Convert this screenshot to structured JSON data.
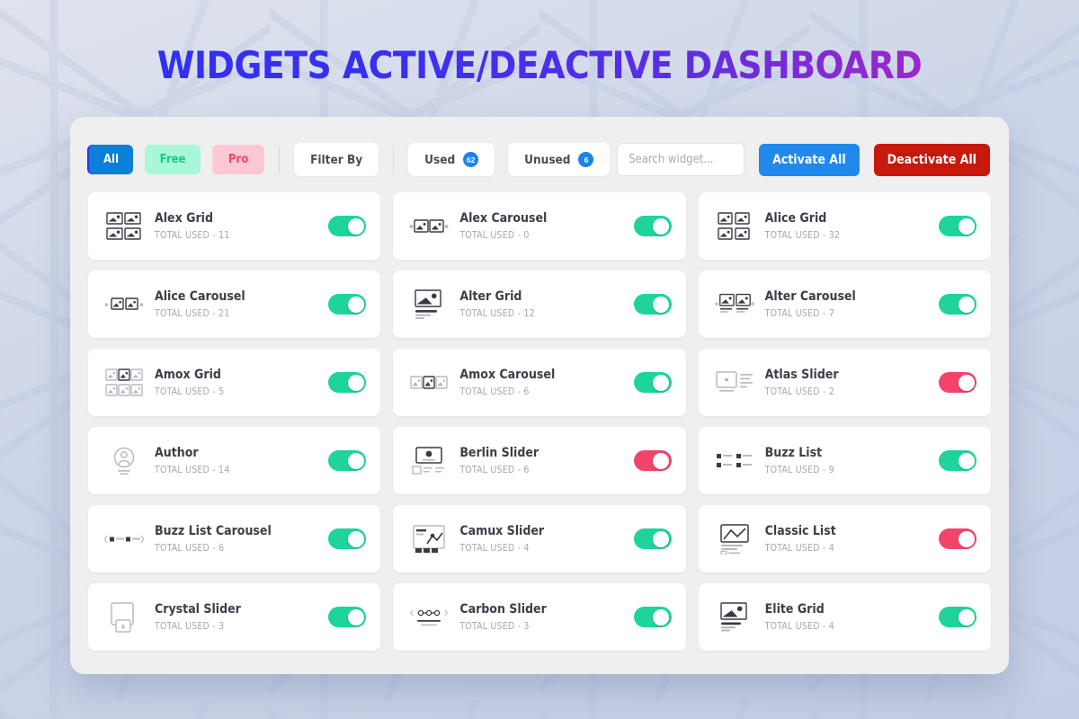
{
  "page": {
    "title": "Widgets Active/Deactive Dashboard",
    "title_gradient_from": "#2f2ff5",
    "title_gradient_to": "#c32bb0"
  },
  "toolbar": {
    "type_filters": [
      {
        "label": "All",
        "state": "active",
        "bg": "#0d7fd6",
        "fg": "#ffffff"
      },
      {
        "label": "Free",
        "state": "default",
        "bg": "#a7f7d8",
        "fg": "#16c98d"
      },
      {
        "label": "Pro",
        "state": "default",
        "bg": "#fcc8d3",
        "fg": "#f2446a"
      }
    ],
    "filter_by_label": "Filter By",
    "usage_chips": [
      {
        "label": "Used",
        "count": "62"
      },
      {
        "label": "Unused",
        "count": "6"
      }
    ],
    "search": {
      "placeholder": "Search widget...",
      "value": ""
    },
    "activate_all_label": "Activate All",
    "deactivate_all_label": "Deactivate All",
    "activate_color": "#2189ec",
    "deactivate_color": "#c7190b"
  },
  "legend": {
    "used_prefix": "TOTAL USED - ",
    "toggle_on_color": "#1ed49c",
    "toggle_off_color": "#f2446b"
  },
  "widgets": [
    {
      "name": "Alex Grid",
      "used": "TOTAL USED - 11",
      "state": "on",
      "icon": "image-grid-2x2-icon"
    },
    {
      "name": "Alex Carousel",
      "used": "TOTAL USED - 0",
      "state": "on",
      "icon": "image-carousel-icon"
    },
    {
      "name": "Alice Grid",
      "used": "TOTAL USED - 32",
      "state": "on",
      "icon": "portrait-grid-2x2-icon"
    },
    {
      "name": "Alice Carousel",
      "used": "TOTAL USED - 21",
      "state": "on",
      "icon": "portrait-carousel-icon"
    },
    {
      "name": "Alter Grid",
      "used": "TOTAL USED - 12",
      "state": "on",
      "icon": "image-text-icon"
    },
    {
      "name": "Alter Carousel",
      "used": "TOTAL USED - 7",
      "state": "on",
      "icon": "image-text-carousel-icon"
    },
    {
      "name": "Amox Grid",
      "used": "TOTAL USED - 5",
      "state": "on",
      "icon": "card-grid-2x3-icon"
    },
    {
      "name": "Amox Carousel",
      "used": "TOTAL USED - 6",
      "state": "on",
      "icon": "card-carousel-icon"
    },
    {
      "name": "Atlas Slider",
      "used": "TOTAL USED - 2",
      "state": "off",
      "icon": "slider-panel-icon"
    },
    {
      "name": "Author",
      "used": "TOTAL USED - 14",
      "state": "on",
      "icon": "author-avatar-icon"
    },
    {
      "name": "Berlin Slider",
      "used": "TOTAL USED - 6",
      "state": "off",
      "icon": "monitor-slider-icon"
    },
    {
      "name": "Buzz List",
      "used": "TOTAL USED - 9",
      "state": "on",
      "icon": "bullet-list-icon"
    },
    {
      "name": "Buzz List Carousel",
      "used": "TOTAL USED - 6",
      "state": "on",
      "icon": "bullet-list-carousel-icon"
    },
    {
      "name": "Camux Slider",
      "used": "TOTAL USED - 4",
      "state": "on",
      "icon": "chart-image-icon"
    },
    {
      "name": "Classic List",
      "used": "TOTAL USED - 4",
      "state": "off",
      "icon": "mountain-list-icon"
    },
    {
      "name": "Crystal Slider",
      "used": "TOTAL USED - 3",
      "state": "on",
      "icon": "document-panel-icon"
    },
    {
      "name": "Carbon Slider",
      "used": "TOTAL USED - 3",
      "state": "on",
      "icon": "dots-slider-icon"
    },
    {
      "name": "Elite Grid",
      "used": "TOTAL USED - 4",
      "state": "on",
      "icon": "photo-lines-icon"
    }
  ]
}
